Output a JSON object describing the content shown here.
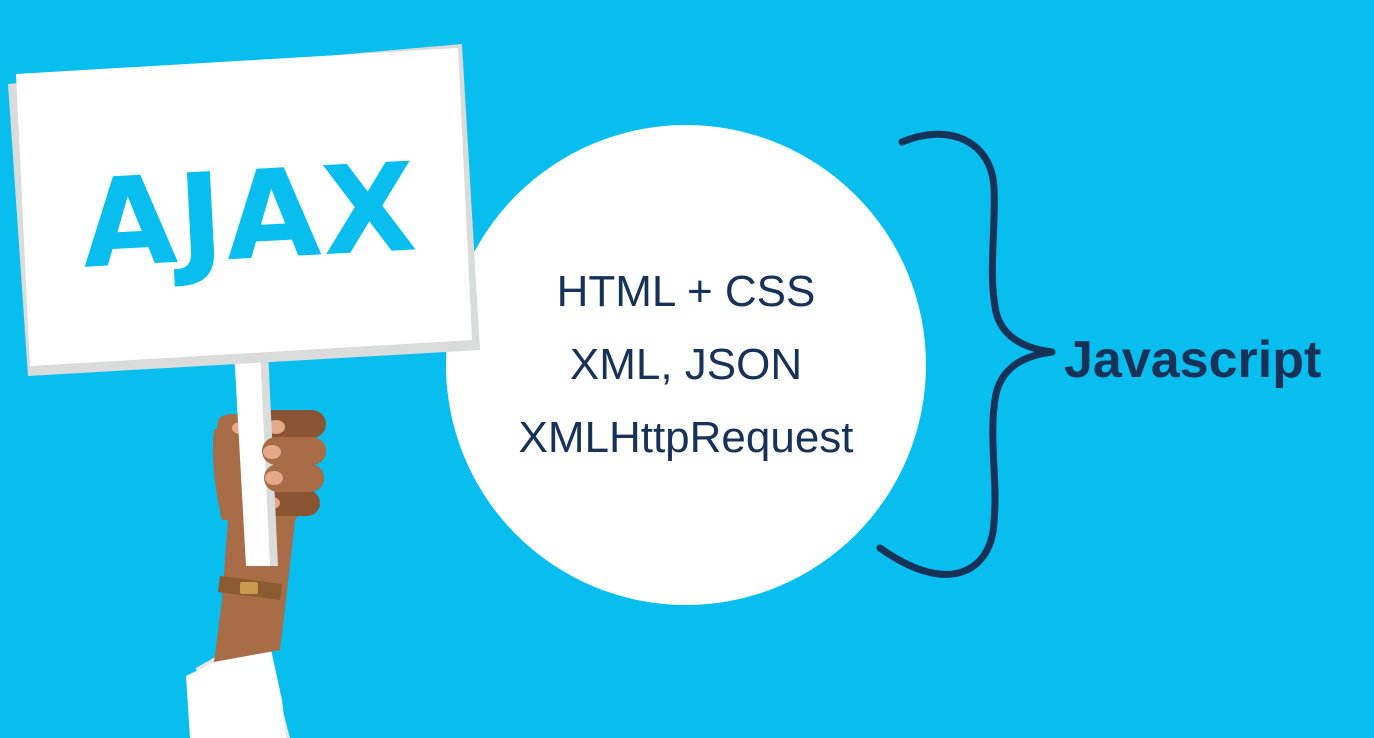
{
  "sign": {
    "text": "AJAX"
  },
  "circle": {
    "lines": [
      "HTML + CSS",
      "XML, JSON",
      "XMLHttpRequest"
    ]
  },
  "brace_label": "Javascript",
  "colors": {
    "background": "#07BEEF",
    "sign_face": "#FFFFFF",
    "sign_edge": "#DADCDC",
    "sign_text": "#07BEEF",
    "circle": "#FFFFFF",
    "navy": "#163258",
    "skin": "#A86C47",
    "skin_shadow": "#8A5433",
    "nails": "#E3A988",
    "watch_strap": "#8A5A30",
    "watch_buckle": "#C99A4A",
    "sleeve": "#FFFFFF",
    "sleeve_shadow": "#E4E6E7"
  },
  "icons": {
    "brace": "right-curly-brace-icon",
    "hand": "raised-hand-illustration",
    "watch": "wristwatch-illustration"
  }
}
